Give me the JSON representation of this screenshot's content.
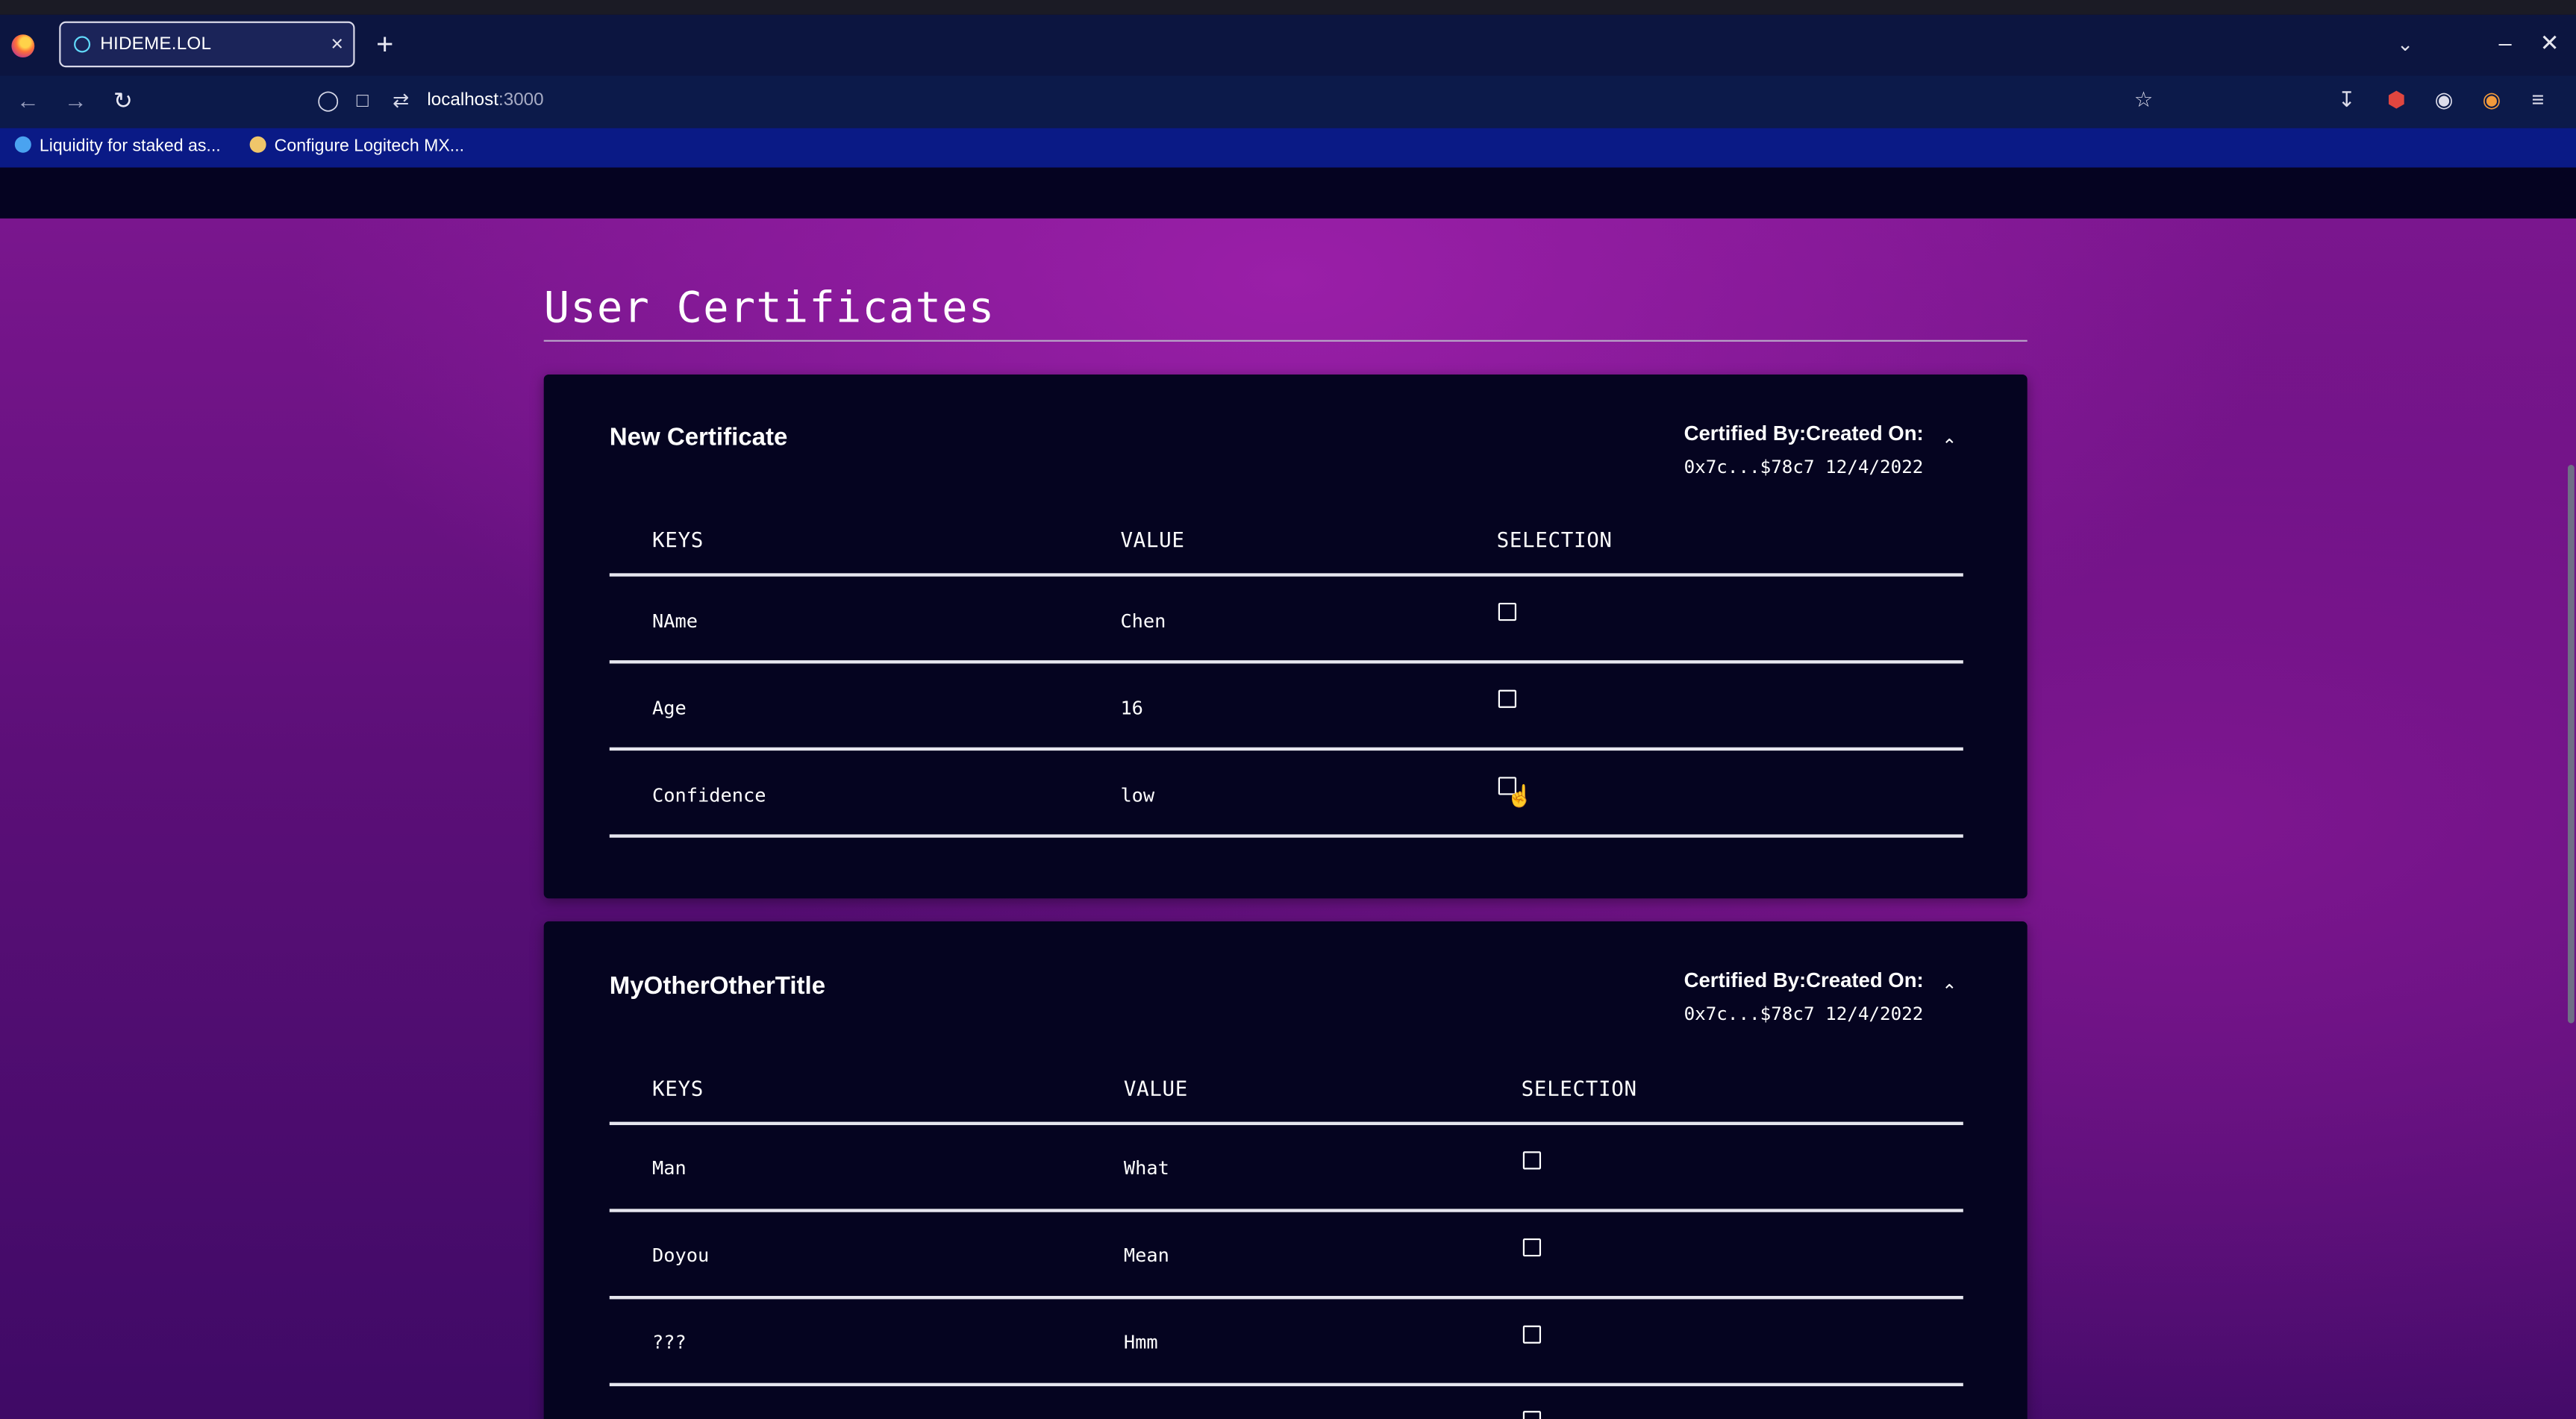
{
  "browser": {
    "tab_title": "HIDEME.LOL",
    "tab_close": "×",
    "new_tab": "+",
    "url_host": "localhost",
    "url_port": ":3000",
    "bookmarks": [
      {
        "label": "Liquidity for staked as...",
        "icon_color": "#4aa3f0",
        "icon": "droplet-icon"
      },
      {
        "label": "Configure Logitech MX...",
        "icon_color": "#f0c66a",
        "icon": "logitech-icon"
      }
    ]
  },
  "page": {
    "title": "User Certificates"
  },
  "certificates": [
    {
      "title": "New Certificate",
      "cert_label": "Certified By:Created On:",
      "certified_by": "0x7c...$78c7",
      "created_on": "12/4/2022",
      "columns": [
        "KEYS",
        "VALUE",
        "SELECTION"
      ],
      "rows": [
        {
          "key": "NAme",
          "value": "Chen",
          "selected": false
        },
        {
          "key": "Age",
          "value": "16",
          "selected": false
        },
        {
          "key": "Confidence",
          "value": "low",
          "selected": false
        }
      ]
    },
    {
      "title": "MyOtherOtherTitle",
      "cert_label": "Certified By:Created On:",
      "certified_by": "0x7c...$78c7",
      "created_on": "12/4/2022",
      "columns": [
        "KEYS",
        "VALUE",
        "SELECTION"
      ],
      "rows": [
        {
          "key": "Man",
          "value": "What",
          "selected": false
        },
        {
          "key": "Doyou",
          "value": "Mean",
          "selected": false
        },
        {
          "key": "???",
          "value": "Hmm",
          "selected": false
        }
      ]
    }
  ]
}
